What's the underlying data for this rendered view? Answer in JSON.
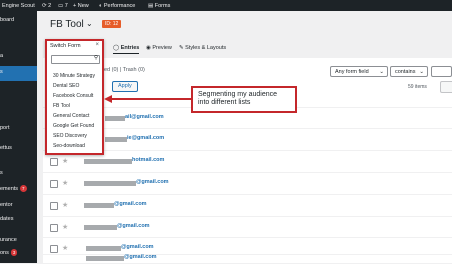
{
  "adminbar": {
    "site": "Engine Scout",
    "updates": "2",
    "comments": "7",
    "new": "+ New",
    "performance": "Performance",
    "forms": "Forms"
  },
  "sidebar": {
    "items": [
      {
        "label": "board"
      },
      {
        "label": "a"
      },
      {
        "label": "s"
      },
      {
        "label": "port"
      },
      {
        "label": "ettus"
      },
      {
        "label": "s"
      },
      {
        "label": "ements",
        "badge": "7"
      },
      {
        "label": "entor"
      },
      {
        "label": "dates"
      },
      {
        "label": "urance"
      },
      {
        "label": "ons",
        "badge": "3"
      }
    ]
  },
  "header": {
    "title": "FB Tool",
    "id_badge": "ID: 12"
  },
  "tabs": {
    "entries": "Entries",
    "preview": "Preview",
    "styles": "Styles & Layouts"
  },
  "subsubsub": {
    "text": "ed (0) | Trash (0)"
  },
  "filter": {
    "field": "Any form field",
    "operator": "contains",
    "apply": "Apply",
    "items_count": "59 items"
  },
  "switch_form": {
    "title": "Switch Form",
    "close": "×",
    "search_placeholder": "",
    "items": [
      "30 Minute Strategy",
      "Dental SEO",
      "Facebook Consult",
      "FB Tool",
      "General Contact",
      "Google Get Found",
      "SEO Discovery",
      "Seo-download"
    ]
  },
  "callout": {
    "text": "Segmenting my audience into different lists"
  },
  "entries": [
    {
      "email": "ail@gmail.com"
    },
    {
      "email": "ie@gmail.com"
    },
    {
      "email": "hotmail.com"
    },
    {
      "email": "@gmail.com"
    },
    {
      "email": "@gmail.com"
    },
    {
      "email": "@gmail.com"
    },
    {
      "email": "@gmail.com"
    },
    {
      "email": "@gmail.com"
    },
    {
      "email": "gmail.com"
    }
  ],
  "colors": {
    "admin_bg": "#1d2327",
    "accent": "#2271b1",
    "highlight_red": "#c4272b",
    "id_badge": "#e65d2a"
  }
}
